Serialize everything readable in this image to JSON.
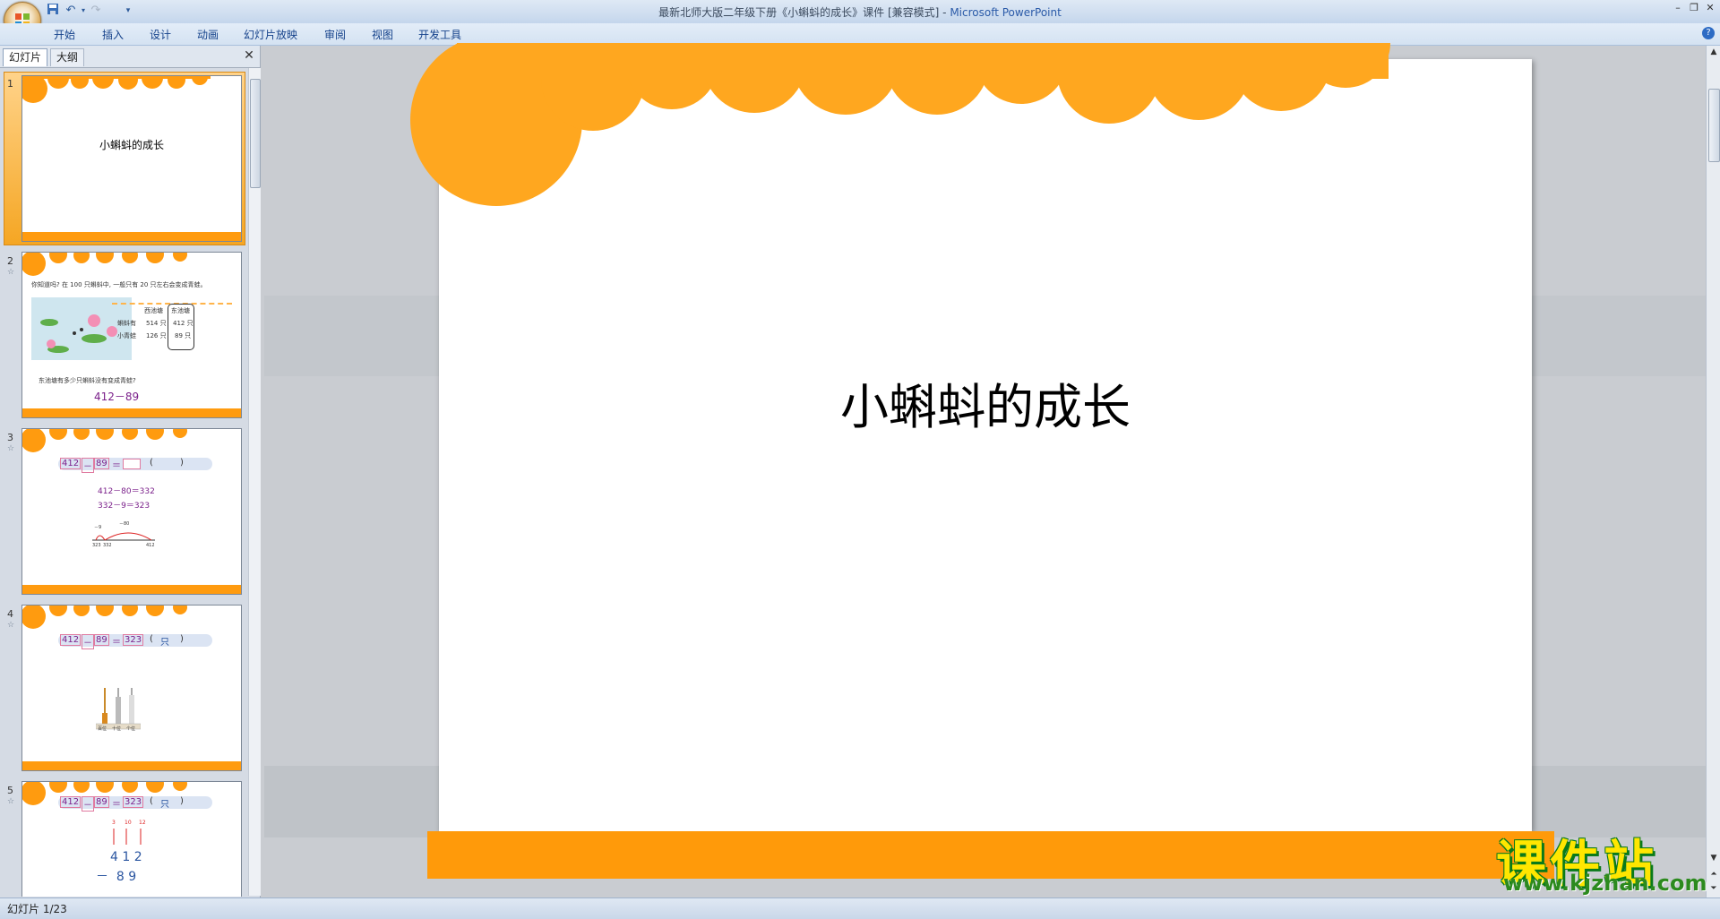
{
  "window": {
    "title_doc": "最新北师大版二年级下册《小蝌蚪的成长》课件 [兼容模式] - ",
    "title_app": "Microsoft PowerPoint"
  },
  "ribbon": {
    "tabs": [
      "开始",
      "插入",
      "设计",
      "动画",
      "幻灯片放映",
      "审阅",
      "视图",
      "开发工具"
    ]
  },
  "pane": {
    "tab_slides": "幻灯片",
    "tab_outline": "大纲"
  },
  "thumbnails": [
    {
      "num": "1",
      "title": "小蝌蚪的成长"
    },
    {
      "num": "2",
      "question": "你知道吗? 在 100 只蝌蚪中, 一般只有 20 只左右会变成青蛙。",
      "table_headers": [
        "",
        "西池塘",
        "东池塘"
      ],
      "table_rows": [
        [
          "蝌蚪有",
          "514 只",
          "412 只"
        ],
        [
          "小青蛙",
          "126 只",
          "89 只"
        ]
      ],
      "ask": "东池塘有多少只蝌蚪没有变成青蛙?",
      "expr": "412－89"
    },
    {
      "num": "3",
      "eq": [
        "412",
        "－",
        "89",
        "＝",
        "",
        "(",
        ")"
      ],
      "lines": [
        "412－80＝332",
        "332－9＝323"
      ],
      "line_labels": [
        "－9",
        "－80",
        "323",
        "332",
        "412"
      ]
    },
    {
      "num": "4",
      "eq": [
        "412",
        "－",
        "89",
        "＝",
        "323",
        "(",
        "只",
        ")"
      ],
      "abacus_labels": [
        "百位",
        "十位",
        "个位"
      ]
    },
    {
      "num": "5",
      "eq": [
        "412",
        "－",
        "89",
        "＝",
        "323",
        "(",
        "只",
        ")"
      ],
      "carry": [
        "3",
        "10",
        "12"
      ],
      "vertical": [
        "4 1 2",
        "－  8 9"
      ]
    }
  ],
  "slide": {
    "title": "小蝌蚪的成长"
  },
  "status": {
    "text": "幻灯片 1/23"
  },
  "watermark": {
    "line1": "课件站",
    "line2": "www.kjzhan.com"
  },
  "colors": {
    "accent_orange": "#ff9b0f",
    "ribbon_text": "#15428b"
  }
}
